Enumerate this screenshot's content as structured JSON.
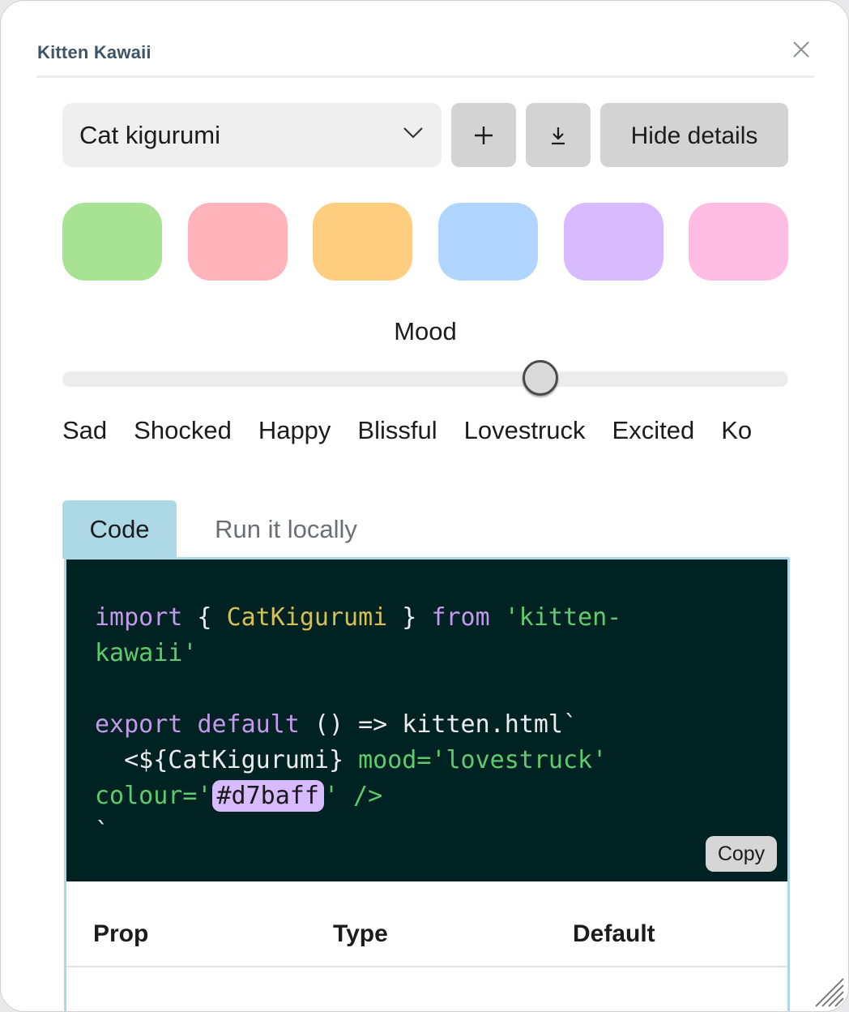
{
  "window": {
    "title": "Kitten Kawaii"
  },
  "toolbar": {
    "selected": "Cat kigurumi",
    "hide_details_label": "Hide details"
  },
  "colors": {
    "swatches": [
      "#a8e393",
      "#ffb3bb",
      "#ffcd7f",
      "#b0d6ff",
      "#d7baff",
      "#ffbde4"
    ],
    "tab_active": "#add8e6",
    "code_background": "#002222",
    "highlight": "#d7baff"
  },
  "icons": {
    "close": "close-icon",
    "select": "chevron-down-icon",
    "add": "plus-icon",
    "download": "download-icon",
    "resize": "resize-grip-icon"
  },
  "mood": {
    "label": "Mood",
    "options": [
      "Sad",
      "Shocked",
      "Happy",
      "Blissful",
      "Lovestruck",
      "Excited",
      "Ko"
    ],
    "value_fraction": 0.659
  },
  "tabs": [
    {
      "label": "Code",
      "active": true
    },
    {
      "label": "Run it locally",
      "active": false
    }
  ],
  "code": {
    "line1_kw": "import",
    "line1_a": " { ",
    "line1_cls": "CatKigurumi",
    "line1_b": " } ",
    "line1_from": "from",
    "line1_sp": " ",
    "line1_str": "'kitten-",
    "line2_str": "kawaii'",
    "line3_kw1": "export",
    "line3_sp": " ",
    "line3_kw2": "default",
    "line3_rest": " () => kitten.html`",
    "line4_pre": "  <${CatKigurumi}",
    "line4_attr": " mood='lovestruck'",
    "line5_a": "colour='",
    "line5_hl": "#d7baff",
    "line5_b": "' />",
    "line6": "`",
    "copy_label": "Copy"
  },
  "props_table": {
    "headers": [
      "Prop",
      "Type",
      "Default"
    ]
  }
}
